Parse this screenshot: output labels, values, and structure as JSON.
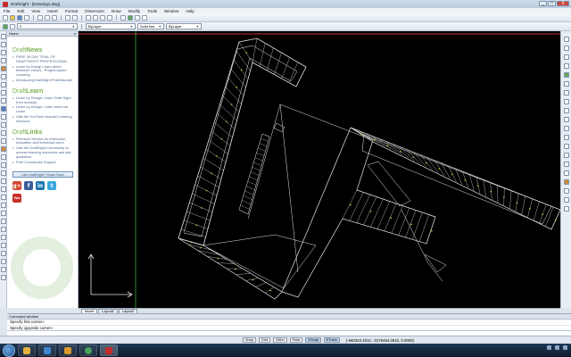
{
  "window": {
    "title": "DraftSight - [Drawing1.dwg]",
    "buttons": [
      "_",
      "□",
      "X"
    ]
  },
  "menu": [
    "File",
    "Edit",
    "View",
    "Insert",
    "Format",
    "Dimension",
    "Draw",
    "Modify",
    "Tools",
    "Window",
    "Help"
  ],
  "properties_toolbar": {
    "layer": "0",
    "color": "ByLayer",
    "linestyle": "Solid line",
    "lineweight": "ByLayer"
  },
  "palette": {
    "title": "Home",
    "close": "x",
    "sections": [
      {
        "heading": "News",
        "items": [
          "FREE 30 DAY TRIAL OF DRAFTSIGHT PROFESSIONAL",
          "Learn by Doing! Learn direct between menus - Project-based Learning",
          "Introducing DraftSight Professional!"
        ]
      },
      {
        "heading": "Learn",
        "items": [
          "Learn by Design: Learn Draft Sight from industry",
          "Learn by Design, Learn more via Learn",
          "Visit the YouTube channel Learning resource"
        ]
      },
      {
        "heading": "Links",
        "items": [
          "Premium Service for enterprise, education and individual users",
          "Visit the DraftSight Community to access learning resources and ask questions",
          "Free Community Support"
        ]
      }
    ],
    "brand_prefix": "Draft",
    "share_label": "Like DraftSight? Share Now!",
    "social": [
      "g+",
      "f",
      "in",
      "t",
      "You"
    ]
  },
  "layout_tabs": [
    "Model",
    "Layout1",
    "Layout2"
  ],
  "command_window": {
    "title": "Command window",
    "lines": [
      "Specify first corner»",
      "Specify opposite corner»"
    ]
  },
  "status_bar": {
    "toggles": [
      {
        "label": "Snap",
        "on": false
      },
      {
        "label": "Grid",
        "on": false
      },
      {
        "label": "Ortho",
        "on": false
      },
      {
        "label": "Polar",
        "on": false
      },
      {
        "label": "ESnap",
        "on": true
      },
      {
        "label": "ETrack",
        "on": true
      }
    ],
    "coordinates": "(-660323.1912, -3179454.3910, 0.0000)"
  },
  "colors": {
    "canvas": "#000000",
    "accent_green": "#79b24e",
    "link_blue": "#4c6a8e",
    "drawing_lines": "#e8e8e8",
    "annotation_yellow": "#e8c84a"
  }
}
